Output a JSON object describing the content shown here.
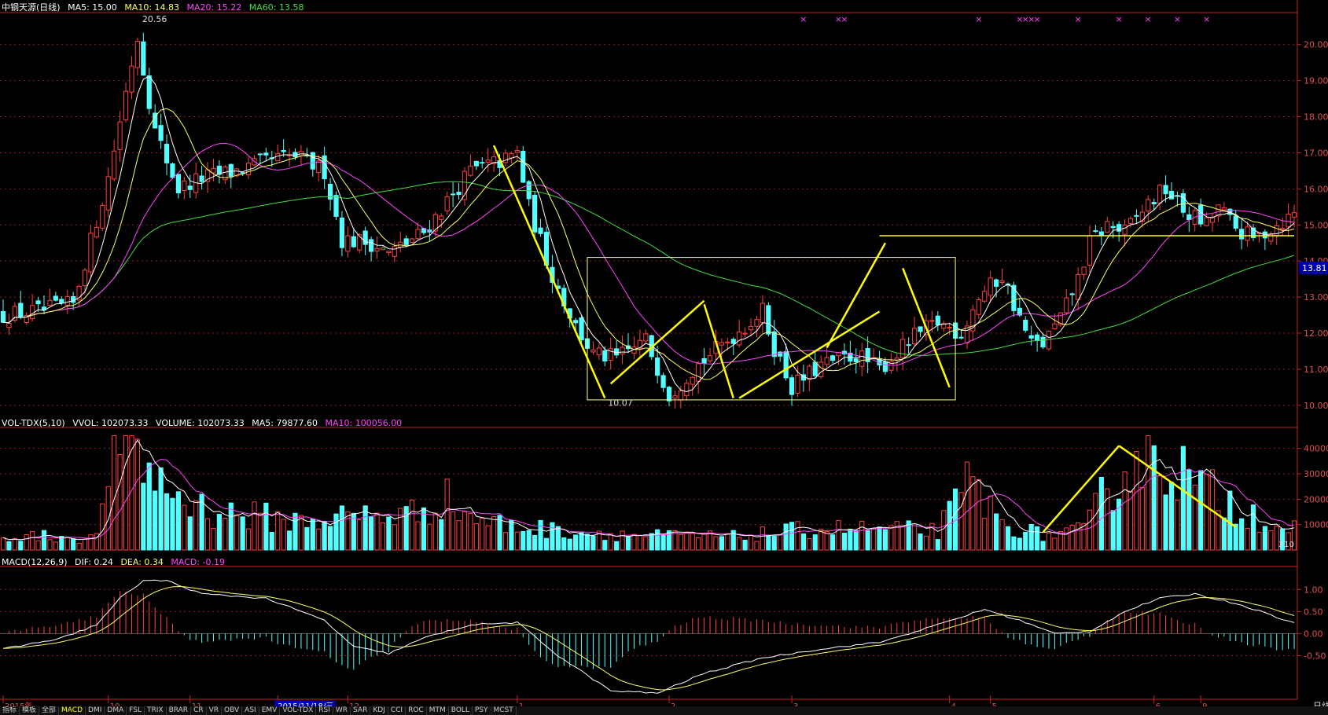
{
  "legend": {
    "price": [
      {
        "text": "中钢天源(日线)",
        "color": "#ffffff"
      },
      {
        "text": "MA5: 15.00",
        "color": "#ffffff"
      },
      {
        "text": "MA10: 14.83",
        "color": "#ffff66"
      },
      {
        "text": "MA20: 15.22",
        "color": "#ff44ff"
      },
      {
        "text": "MA60: 13.58",
        "color": "#44dd44"
      }
    ],
    "volume": [
      {
        "text": "VOL-TDX(5,10)",
        "color": "#ffffff"
      },
      {
        "text": "VVOL: 102073.33",
        "color": "#ffffff"
      },
      {
        "text": "VOLUME: 102073.33",
        "color": "#ffffff"
      },
      {
        "text": "MA5: 79877.60",
        "color": "#ffffff"
      },
      {
        "text": "MA10: 100056.00",
        "color": "#ff44ff"
      }
    ],
    "macd": [
      {
        "text": "MACD(12,26,9)",
        "color": "#ffffff"
      },
      {
        "text": "DIF: 0.24",
        "color": "#ffffff"
      },
      {
        "text": "DEA: 0.34",
        "color": "#ffff66"
      },
      {
        "text": "MACD: -0.19",
        "color": "#ff44ff"
      }
    ]
  },
  "annotations": {
    "high_label": "20.56",
    "low_label": "10.07",
    "price_tag": "13.81",
    "vol_unit": "X10"
  },
  "x_axis": {
    "labels": [
      {
        "text": "2015年",
        "i": 0
      },
      {
        "text": "10",
        "i": 18
      },
      {
        "text": "11",
        "i": 32
      },
      {
        "text": "2015/11/18/三",
        "i": 47,
        "highlight": true
      },
      {
        "text": "12",
        "i": 59
      },
      {
        "text": "1",
        "i": 88
      },
      {
        "text": "2",
        "i": 114
      },
      {
        "text": "3",
        "i": 135
      },
      {
        "text": "4",
        "i": 162
      },
      {
        "text": "5",
        "i": 169
      },
      {
        "text": "6",
        "i": 197
      },
      {
        "text": "9",
        "i": 205
      }
    ],
    "period_label": "日线"
  },
  "tabs": {
    "items": [
      "指标",
      "模板",
      "全部",
      "MACD",
      "DMI",
      "DMA",
      "FSL",
      "TRIX",
      "BRAR",
      "CR",
      "VR",
      "OBV",
      "ASI",
      "EMV",
      "VOL-TDX",
      "RSI",
      "WR",
      "SAR",
      "KDJ",
      "CCI",
      "ROC",
      "MTM",
      "BOLL",
      "PSY",
      "MCST"
    ],
    "active": "MACD"
  },
  "colors": {
    "up": "#ff4040",
    "down": "#54ffff",
    "grid": "#8b1a1a",
    "axis": "#cc2222",
    "ma5": "#ffffff",
    "ma10": "#ffff66",
    "ma20": "#ff44ff",
    "ma60": "#44dd44",
    "overlay": "#ffff00"
  },
  "chart_data": [
    {
      "type": "candlestick",
      "title": "中钢天源(日线)",
      "y_ticks": [
        10.0,
        11.0,
        12.0,
        13.0,
        14.0,
        15.0,
        16.0,
        17.0,
        18.0,
        19.0,
        20.0
      ],
      "ylim": [
        9.8,
        20.8
      ],
      "series_names": [
        "MA5",
        "MA10",
        "MA20",
        "MA60"
      ],
      "knots": [
        [
          0,
          12.5
        ],
        [
          6,
          12.6
        ],
        [
          12,
          12.8
        ],
        [
          18,
          16.3
        ],
        [
          22,
          19.5
        ],
        [
          23,
          20.2
        ],
        [
          26,
          17.6
        ],
        [
          30,
          16.0
        ],
        [
          34,
          16.3
        ],
        [
          40,
          16.5
        ],
        [
          46,
          16.8
        ],
        [
          50,
          16.9
        ],
        [
          55,
          16.5
        ],
        [
          58,
          14.6
        ],
        [
          63,
          14.5
        ],
        [
          66,
          14.2
        ],
        [
          72,
          14.8
        ],
        [
          80,
          16.5
        ],
        [
          86,
          16.8
        ],
        [
          88,
          17.0
        ],
        [
          90,
          15.5
        ],
        [
          94,
          13.6
        ],
        [
          98,
          12.2
        ],
        [
          101,
          11.4
        ],
        [
          105,
          11.3
        ],
        [
          110,
          11.8
        ],
        [
          113,
          10.7
        ],
        [
          114,
          10.3
        ],
        [
          118,
          11.0
        ],
        [
          124,
          11.8
        ],
        [
          130,
          12.6
        ],
        [
          132,
          11.6
        ],
        [
          135,
          10.5
        ],
        [
          140,
          11.1
        ],
        [
          146,
          11.4
        ],
        [
          150,
          11.0
        ],
        [
          156,
          11.9
        ],
        [
          160,
          12.3
        ],
        [
          164,
          12.0
        ],
        [
          167,
          13.0
        ],
        [
          171,
          13.6
        ],
        [
          174,
          12.4
        ],
        [
          176,
          11.7
        ],
        [
          178,
          11.7
        ],
        [
          181,
          12.4
        ],
        [
          184,
          13.5
        ],
        [
          186,
          14.5
        ],
        [
          189,
          15.0
        ],
        [
          192,
          14.8
        ],
        [
          196,
          15.6
        ],
        [
          199,
          16.0
        ],
        [
          202,
          15.4
        ],
        [
          206,
          15.0
        ],
        [
          208,
          15.5
        ],
        [
          211,
          14.9
        ],
        [
          214,
          14.6
        ],
        [
          218,
          15.0
        ],
        [
          221,
          15.3
        ]
      ],
      "high_label": 20.56,
      "low_label": 10.07
    },
    {
      "type": "bar",
      "title": "VOL-TDX(5,10)",
      "y_ticks": [
        10000,
        20000,
        30000,
        40000
      ],
      "ylim": [
        0,
        47000
      ],
      "series_names": [
        "MA5",
        "MA10"
      ],
      "knots": [
        [
          0,
          6000
        ],
        [
          16,
          5000
        ],
        [
          18,
          40000
        ],
        [
          22,
          44000
        ],
        [
          26,
          30000
        ],
        [
          30,
          22000
        ],
        [
          36,
          16000
        ],
        [
          50,
          12000
        ],
        [
          60,
          14000
        ],
        [
          70,
          15000
        ],
        [
          75,
          22000
        ],
        [
          80,
          14000
        ],
        [
          86,
          10000
        ],
        [
          95,
          8000
        ],
        [
          110,
          6000
        ],
        [
          125,
          5500
        ],
        [
          140,
          9000
        ],
        [
          160,
          8000
        ],
        [
          163,
          18000
        ],
        [
          166,
          30000
        ],
        [
          170,
          12000
        ],
        [
          178,
          6000
        ],
        [
          185,
          8000
        ],
        [
          190,
          30000
        ],
        [
          196,
          41000
        ],
        [
          200,
          38000
        ],
        [
          204,
          26000
        ],
        [
          210,
          20000
        ],
        [
          220,
          8000
        ],
        [
          221,
          9000
        ]
      ]
    },
    {
      "type": "bar",
      "title": "MACD(12,26,9)",
      "y_ticks": [
        -0.5,
        0.0,
        0.5,
        1.0
      ],
      "ylim": [
        -1.4,
        1.45
      ],
      "series_names": [
        "DIF",
        "DEA",
        "MACD"
      ],
      "knots": [
        [
          0,
          -0.35
        ],
        [
          10,
          -0.1
        ],
        [
          16,
          0.2
        ],
        [
          20,
          0.8
        ],
        [
          24,
          1.2
        ],
        [
          28,
          1.2
        ],
        [
          34,
          0.9
        ],
        [
          45,
          0.8
        ],
        [
          55,
          0.3
        ],
        [
          60,
          -0.3
        ],
        [
          66,
          -0.45
        ],
        [
          72,
          -0.1
        ],
        [
          80,
          0.2
        ],
        [
          88,
          0.25
        ],
        [
          95,
          -0.5
        ],
        [
          104,
          -1.3
        ],
        [
          112,
          -1.35
        ],
        [
          120,
          -0.9
        ],
        [
          130,
          -0.55
        ],
        [
          140,
          -0.35
        ],
        [
          150,
          -0.2
        ],
        [
          160,
          0.2
        ],
        [
          168,
          0.55
        ],
        [
          174,
          0.3
        ],
        [
          180,
          0.0
        ],
        [
          186,
          0.05
        ],
        [
          192,
          0.5
        ],
        [
          198,
          0.8
        ],
        [
          204,
          0.9
        ],
        [
          212,
          0.65
        ],
        [
          221,
          0.24
        ]
      ]
    }
  ]
}
